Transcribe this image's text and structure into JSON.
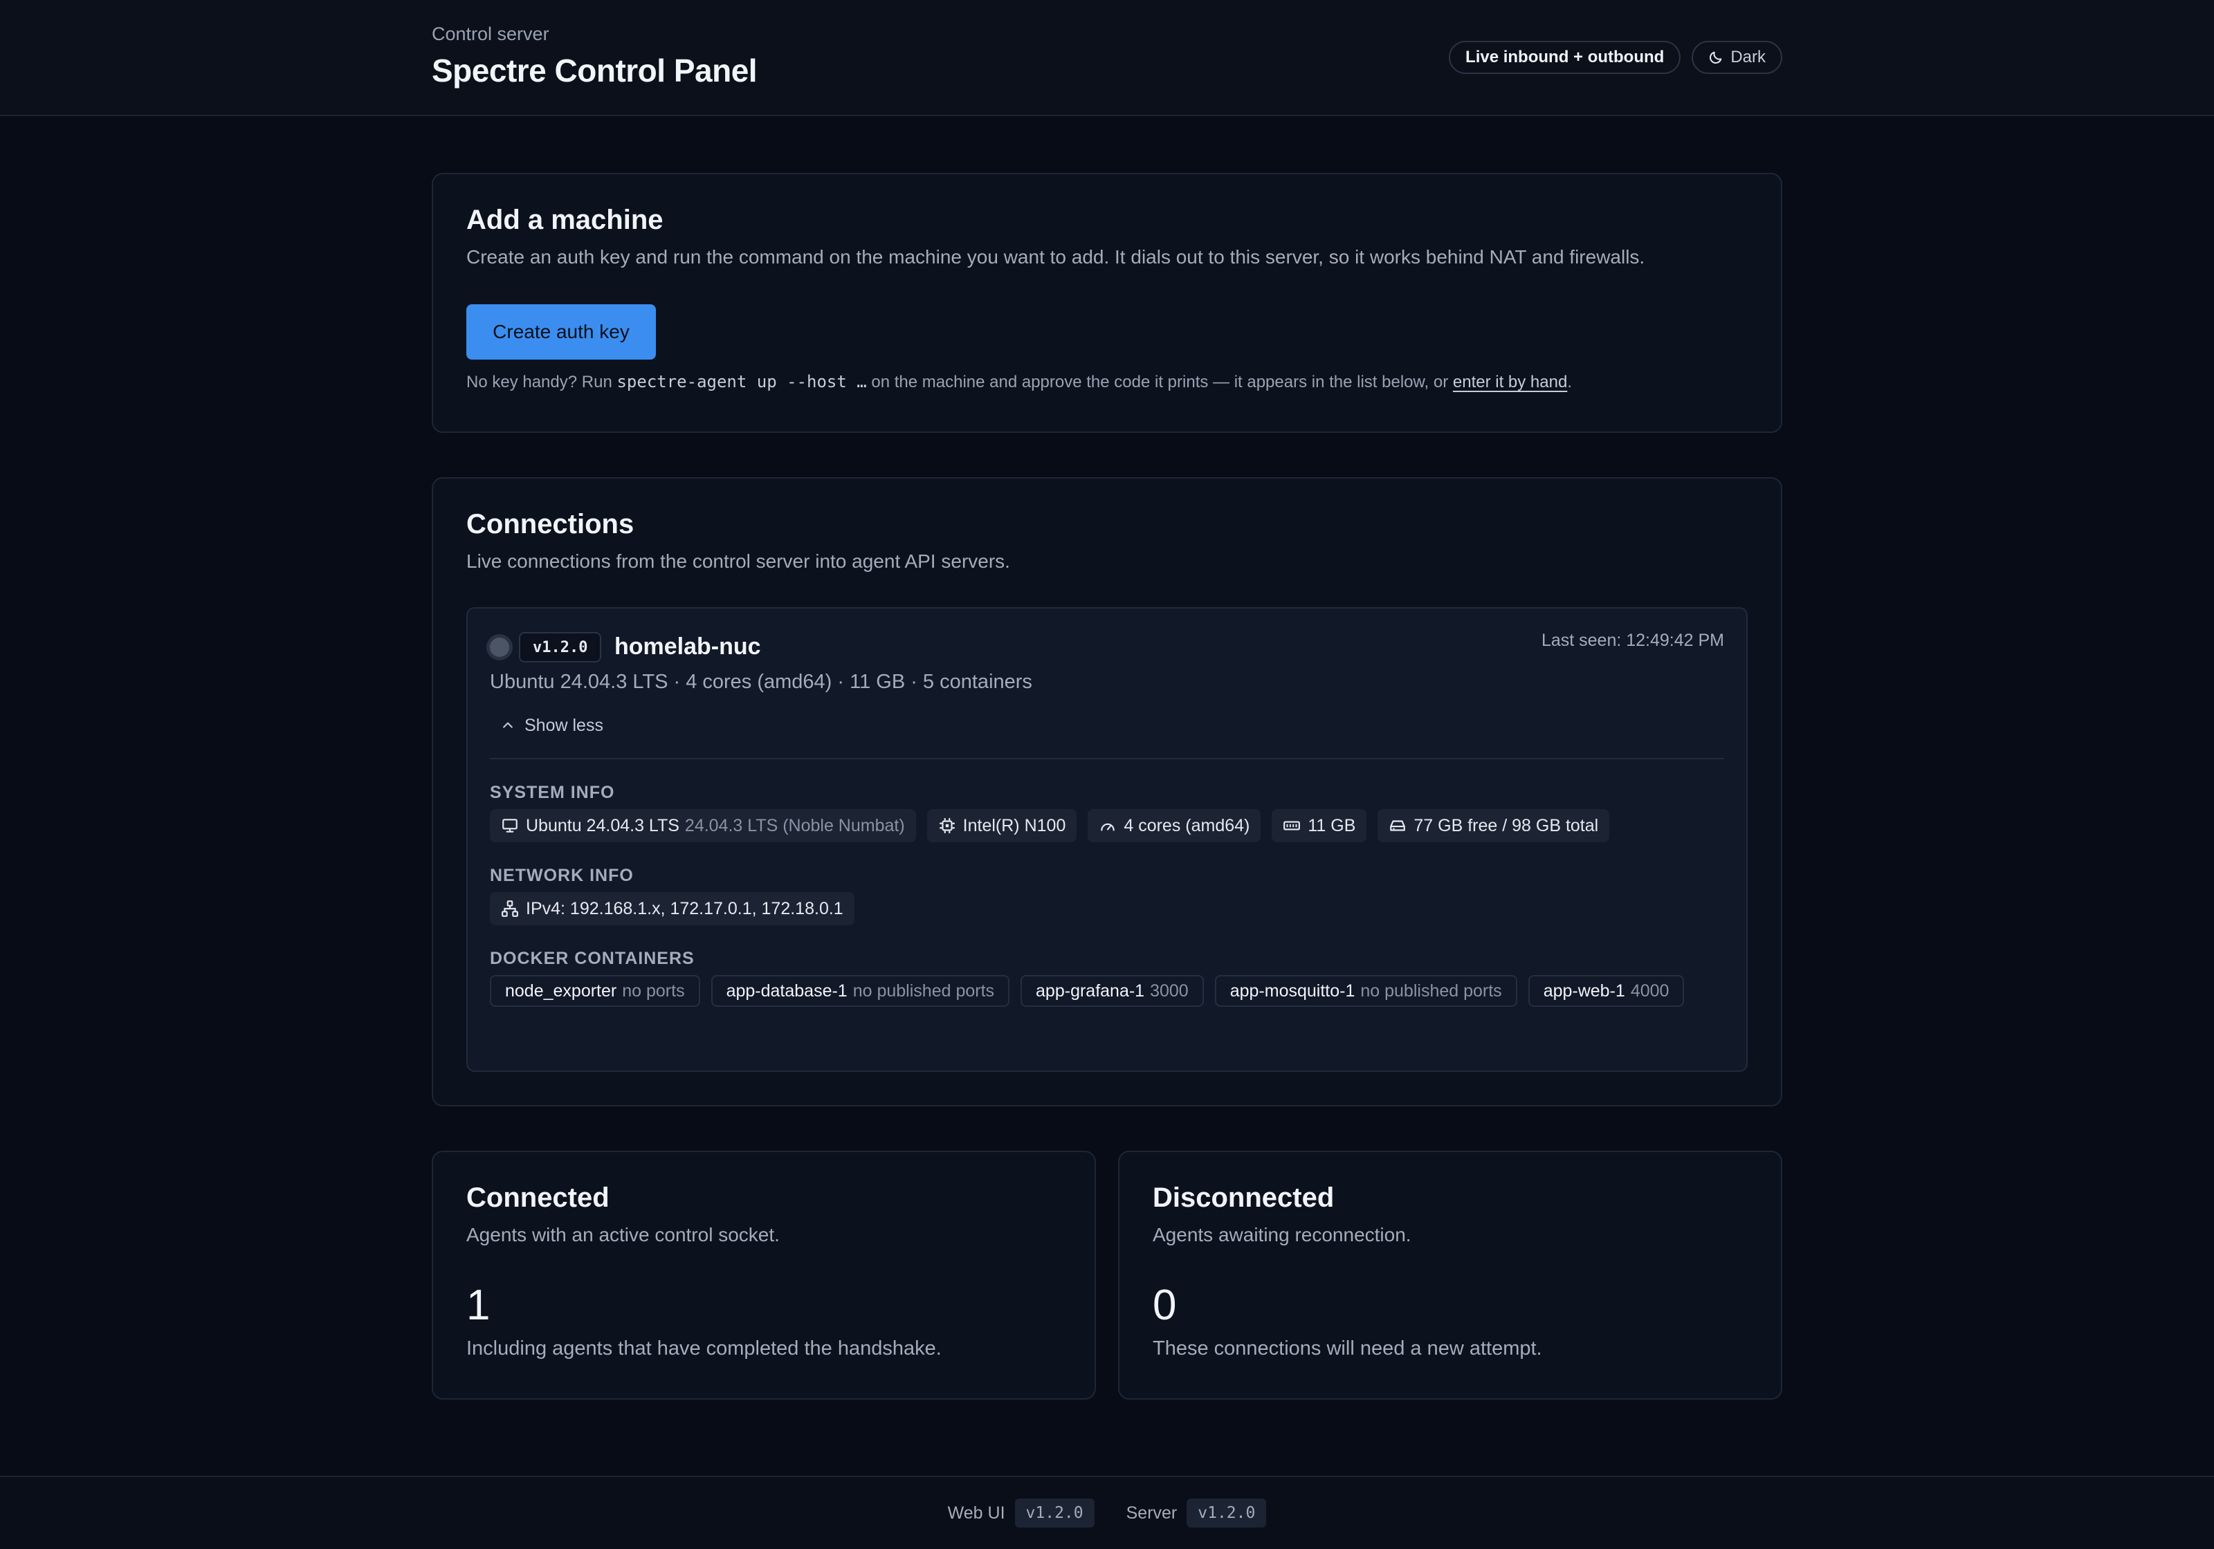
{
  "header": {
    "eyebrow": "Control server",
    "title": "Spectre Control Panel",
    "live_label": "Live inbound + outbound",
    "theme_label": "Dark"
  },
  "add_machine": {
    "title": "Add a machine",
    "subtitle": "Create an auth key and run the command on the machine you want to add. It dials out to this server, so it works behind NAT and firewalls.",
    "button_label": "Create auth key",
    "hint_prefix": "No key handy? Run",
    "hint_command": "spectre-agent up --host …",
    "hint_middle": "on the machine and approve the code it prints — it appears in the list below, or",
    "hint_link": "enter it by hand",
    "hint_suffix": "."
  },
  "connections": {
    "title": "Connections",
    "subtitle": "Live connections from the control server into agent API servers.",
    "machine": {
      "version": "v1.2.0",
      "name": "homelab-nuc",
      "last_seen": "Last seen: 12:49:42 PM",
      "summary": "Ubuntu 24.04.3 LTS · 4 cores (amd64) · 11 GB · 5 containers",
      "toggle_label": "Show less",
      "system_label": "SYSTEM INFO",
      "system_chips": [
        {
          "icon": "monitor-icon",
          "text": "Ubuntu 24.04.3 LTS",
          "muted": "24.04.3 LTS (Noble Numbat)"
        },
        {
          "icon": "cpu-icon",
          "text": "Intel(R) N100",
          "muted": ""
        },
        {
          "icon": "gauge-icon",
          "text": "4 cores (amd64)",
          "muted": ""
        },
        {
          "icon": "memory-icon",
          "text": "11 GB",
          "muted": ""
        },
        {
          "icon": "drive-icon",
          "text": "77 GB free / 98 GB total",
          "muted": ""
        }
      ],
      "network_label": "NETWORK INFO",
      "network_chips": [
        {
          "icon": "network-icon",
          "text": "IPv4: 192.168.1.x, 172.17.0.1, 172.18.0.1"
        }
      ],
      "docker_label": "DOCKER CONTAINERS",
      "containers": [
        {
          "name": "node_exporter",
          "ports": "no ports"
        },
        {
          "name": "app-database-1",
          "ports": "no published ports"
        },
        {
          "name": "app-grafana-1",
          "ports": "3000"
        },
        {
          "name": "app-mosquitto-1",
          "ports": "no published ports"
        },
        {
          "name": "app-web-1",
          "ports": "4000"
        }
      ]
    }
  },
  "connected": {
    "title": "Connected",
    "subtitle": "Agents with an active control socket.",
    "count": "1",
    "note": "Including agents that have completed the handshake."
  },
  "disconnected": {
    "title": "Disconnected",
    "subtitle": "Agents awaiting reconnection.",
    "count": "0",
    "note": "These connections will need a new attempt."
  },
  "footer": {
    "web_ui_label": "Web UI",
    "web_ui_version": "v1.2.0",
    "server_label": "Server",
    "server_version": "v1.2.0"
  },
  "colors": {
    "background": "#080c16",
    "card": "#0c111e",
    "accent": "#3b8ef0",
    "status_offline": "#4b5566"
  }
}
